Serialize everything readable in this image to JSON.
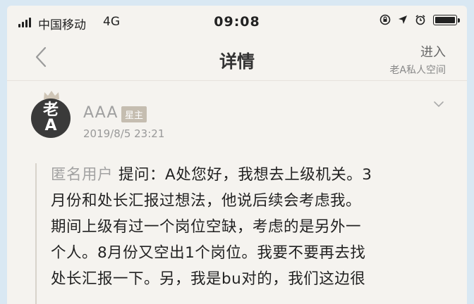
{
  "status_bar": {
    "carrier": "中国移动",
    "network": "4G",
    "time": "09:08",
    "battery_level": 1.0
  },
  "nav": {
    "back_icon": "chevron-left-icon",
    "title": "详情",
    "enter_label": "进入",
    "space_label": "老A私人空间"
  },
  "post": {
    "avatar_text_top": "老",
    "avatar_text_bottom": "A",
    "author": "AAA",
    "role_badge": "星主",
    "date": "2019/8/5 23:21"
  },
  "question": {
    "asker": "匿名用户",
    "lines": [
      "提问：A处您好，我想去上级机关。3",
      "月份和处长汇报过想法，他说后续会考虑我。",
      "期间上级有过一个岗位空缺，考虑的是另外一",
      "个人。8月份又空出1个岗位。我要不要再去找",
      "处长汇报一下。另，我是bu对的，我们这边很"
    ]
  },
  "colors": {
    "background": "#f5f3ef",
    "avatar": "#3a3a3a",
    "badge": "#c5bdb0",
    "muted_text": "#a0a0a0"
  }
}
